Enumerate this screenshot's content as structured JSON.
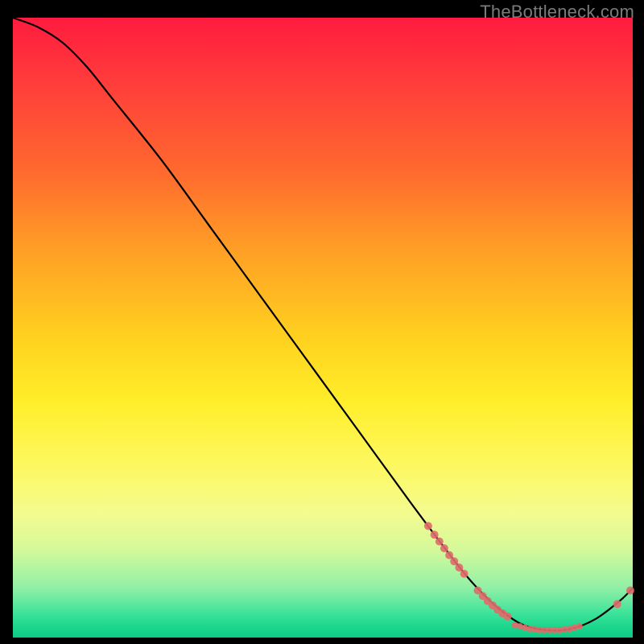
{
  "watermark": "TheBottleneck.com",
  "chart_data": {
    "type": "line",
    "title": "",
    "xlabel": "",
    "ylabel": "",
    "xlim": [
      0,
      100
    ],
    "ylim": [
      0,
      100
    ],
    "curve": [
      {
        "x": 0,
        "y": 100
      },
      {
        "x": 4,
        "y": 98.5
      },
      {
        "x": 8,
        "y": 96
      },
      {
        "x": 12,
        "y": 92
      },
      {
        "x": 16,
        "y": 87
      },
      {
        "x": 24,
        "y": 77
      },
      {
        "x": 32,
        "y": 66
      },
      {
        "x": 40,
        "y": 55
      },
      {
        "x": 48,
        "y": 44
      },
      {
        "x": 56,
        "y": 33
      },
      {
        "x": 64,
        "y": 22
      },
      {
        "x": 70,
        "y": 14
      },
      {
        "x": 74,
        "y": 9
      },
      {
        "x": 78,
        "y": 5
      },
      {
        "x": 82,
        "y": 2.2
      },
      {
        "x": 86,
        "y": 1.2
      },
      {
        "x": 90,
        "y": 1.4
      },
      {
        "x": 94,
        "y": 3.0
      },
      {
        "x": 98,
        "y": 6.0
      },
      {
        "x": 100,
        "y": 8.0
      }
    ],
    "points": [
      {
        "x": 67.0,
        "y": 18.0,
        "r": 5
      },
      {
        "x": 68.0,
        "y": 16.6,
        "r": 5
      },
      {
        "x": 68.8,
        "y": 15.5,
        "r": 5
      },
      {
        "x": 69.6,
        "y": 14.4,
        "r": 5
      },
      {
        "x": 70.4,
        "y": 13.3,
        "r": 5
      },
      {
        "x": 71.2,
        "y": 12.3,
        "r": 5
      },
      {
        "x": 72.0,
        "y": 11.3,
        "r": 5
      },
      {
        "x": 72.8,
        "y": 10.3,
        "r": 5
      },
      {
        "x": 75.0,
        "y": 7.6,
        "r": 5
      },
      {
        "x": 75.8,
        "y": 6.7,
        "r": 5
      },
      {
        "x": 76.6,
        "y": 5.9,
        "r": 5
      },
      {
        "x": 77.4,
        "y": 5.2,
        "r": 5
      },
      {
        "x": 78.2,
        "y": 4.5,
        "r": 5
      },
      {
        "x": 79.0,
        "y": 3.9,
        "r": 5
      },
      {
        "x": 79.8,
        "y": 3.4,
        "r": 5
      },
      {
        "x": 81.0,
        "y": 2.0,
        "r": 4
      },
      {
        "x": 81.8,
        "y": 1.8,
        "r": 4
      },
      {
        "x": 82.6,
        "y": 1.6,
        "r": 4
      },
      {
        "x": 83.4,
        "y": 1.4,
        "r": 4
      },
      {
        "x": 84.2,
        "y": 1.3,
        "r": 4
      },
      {
        "x": 85.0,
        "y": 1.2,
        "r": 4
      },
      {
        "x": 85.8,
        "y": 1.2,
        "r": 4
      },
      {
        "x": 86.6,
        "y": 1.2,
        "r": 4
      },
      {
        "x": 87.4,
        "y": 1.2,
        "r": 4
      },
      {
        "x": 88.2,
        "y": 1.2,
        "r": 4
      },
      {
        "x": 89.0,
        "y": 1.3,
        "r": 4
      },
      {
        "x": 89.8,
        "y": 1.4,
        "r": 4
      },
      {
        "x": 90.6,
        "y": 1.6,
        "r": 4
      },
      {
        "x": 91.4,
        "y": 1.8,
        "r": 4
      },
      {
        "x": 97.5,
        "y": 5.4,
        "r": 5
      },
      {
        "x": 99.6,
        "y": 7.6,
        "r": 5
      }
    ],
    "colors": {
      "curve": "#000000",
      "point": "#e16a6a",
      "gradient_top": "#ff1b3f",
      "gradient_bottom": "#0dca83"
    }
  }
}
